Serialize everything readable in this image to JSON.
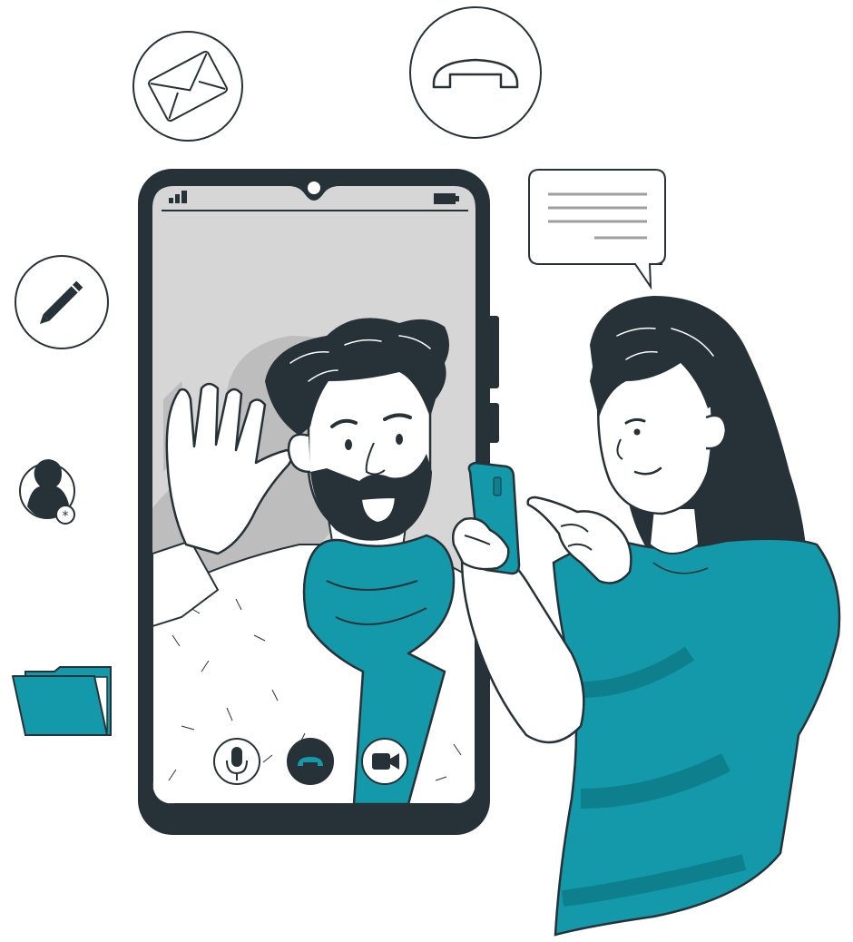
{
  "colors": {
    "ink": "#263238",
    "teal": "#1399a9",
    "teal_dark": "#0e7f8c",
    "screen_bg": "#d6d6d6",
    "shadow": "#bdbdbd",
    "skin": "#ffffff",
    "line_gray": "#9e9e9e"
  },
  "icons": {
    "email": "envelope-icon",
    "call": "phone-hangup-icon",
    "message": "chat-bubble-icon",
    "edit": "pencil-icon",
    "contact": "user-settings-icon",
    "folder": "folder-icon"
  },
  "phone": {
    "status_icons": [
      "signal-icon",
      "battery-icon"
    ],
    "controls": [
      "microphone-icon",
      "end-call-icon",
      "video-camera-icon"
    ]
  }
}
